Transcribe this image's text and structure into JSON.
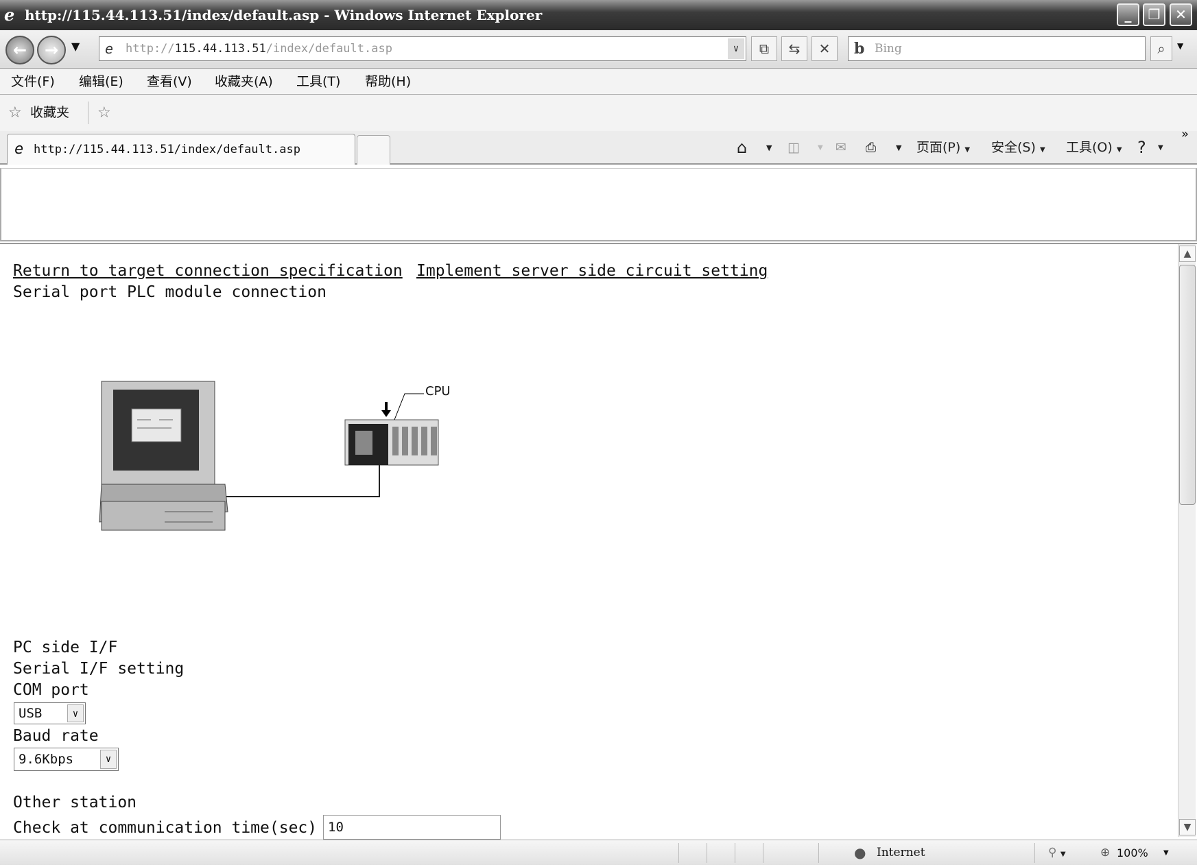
{
  "window": {
    "title": "http://115.44.113.51/index/default.asp - Windows Internet Explorer"
  },
  "address": {
    "prefix": "http://",
    "host": "115.44.113.51",
    "path": "/index/default.asp"
  },
  "search": {
    "placeholder": "Bing"
  },
  "menu": [
    "文件(F)",
    "编辑(E)",
    "查看(V)",
    "收藏夹(A)",
    "工具(T)",
    "帮助(H)"
  ],
  "favorites": {
    "label": "收藏夹"
  },
  "tab": {
    "label": "http://115.44.113.51/index/default.asp"
  },
  "command_bar": {
    "page": "页面(P)",
    "safety": "安全(S)",
    "tools": "工具(O)",
    "more": "»"
  },
  "content": {
    "link_return": "Return to target connection specification",
    "link_implement": "Implement server side circuit setting",
    "heading": "Serial port PLC module connection",
    "diagram_cpu_label": "CPU",
    "pc_side": "PC side I/F",
    "serial_setting": "Serial I/F setting",
    "com_port_label": "COM port",
    "com_port_value": "USB",
    "baud_label": "Baud rate",
    "baud_value": "9.6Kbps",
    "other_station": "Other station",
    "check_time_label": "Check at communication time(sec)",
    "check_time_value": "10"
  },
  "status": {
    "zone": "Internet",
    "zoom": "100%"
  }
}
